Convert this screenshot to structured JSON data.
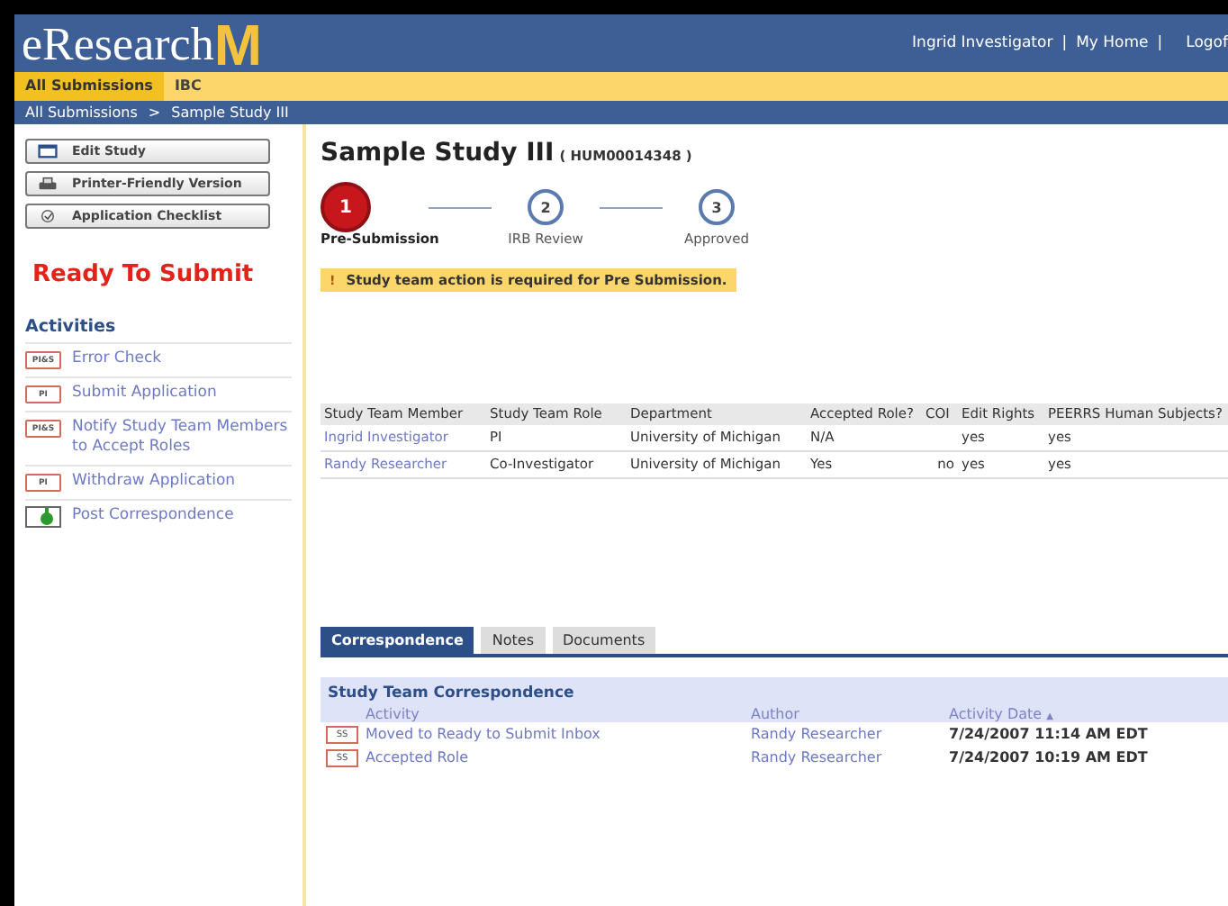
{
  "header": {
    "logo": "eResearch",
    "logo_mark": "M",
    "user_links": [
      "Ingrid Investigator",
      "|",
      "My Home",
      "|",
      "Logof"
    ]
  },
  "nav_tabs": [
    {
      "label": "All Submissions",
      "selected": true
    },
    {
      "label": "IBC",
      "selected": false
    }
  ],
  "breadcrumb": [
    "All Submissions",
    ">",
    "Sample Study III"
  ],
  "sidebar": {
    "buttons": [
      {
        "label": "Edit Study",
        "kind": "edit"
      },
      {
        "label": "Printer-Friendly Version",
        "kind": "print"
      },
      {
        "label": "Application Checklist",
        "kind": "check"
      }
    ],
    "status": "Ready To Submit",
    "activities_title": "Activities",
    "activities": [
      {
        "badge": "PI&S",
        "label": "Error Check",
        "kind": "badge"
      },
      {
        "badge": "PI",
        "label": "Submit Application",
        "kind": "badge"
      },
      {
        "badge": "PI&S",
        "label": "Notify Study Team Members to Accept Roles",
        "kind": "badge"
      },
      {
        "badge": "PI",
        "label": "Withdraw Application",
        "kind": "badge"
      },
      {
        "label": "Post Correspondence",
        "kind": "post"
      }
    ]
  },
  "study": {
    "title": "Sample Study III",
    "id": "( HUM00014348 )"
  },
  "steps": [
    {
      "number": "1",
      "label": "Pre-Submission",
      "selected": true
    },
    {
      "number": "2",
      "label": "IRB Review",
      "selected": false
    },
    {
      "number": "3",
      "label": "Approved",
      "selected": false
    }
  ],
  "alert": {
    "icon": "!",
    "text": "Study team action is required for Pre Submission."
  },
  "team_table": {
    "columns": [
      "Study Team Member",
      "Study Team Role",
      "Department",
      "Accepted Role?",
      "COI",
      "Edit Rights",
      "PEERRS Human Subjects?"
    ],
    "rows": [
      [
        "Ingrid Investigator",
        "PI",
        "University of Michigan",
        "N/A",
        "",
        "yes",
        "yes"
      ],
      [
        "Randy Researcher",
        "Co-Investigator",
        "University of Michigan",
        "Yes",
        "no",
        "yes",
        "yes"
      ]
    ]
  },
  "tabs": [
    {
      "label": "Correspondence",
      "selected": true
    },
    {
      "label": "Notes",
      "selected": false
    },
    {
      "label": "Documents",
      "selected": false
    }
  ],
  "correspondence": {
    "title": "Study Team Correspondence",
    "columns": [
      "Activity",
      "Author",
      "Activity Date"
    ],
    "sort_icon": "▲",
    "rows": [
      {
        "badge": "SS",
        "activity": "Moved to Ready to Submit Inbox",
        "author": "Randy Researcher",
        "date": "7/24/2007 11:14 AM EDT"
      },
      {
        "badge": "SS",
        "activity": "Accepted Role",
        "author": "Randy Researcher",
        "date": "7/24/2007 10:19 AM EDT"
      }
    ]
  }
}
